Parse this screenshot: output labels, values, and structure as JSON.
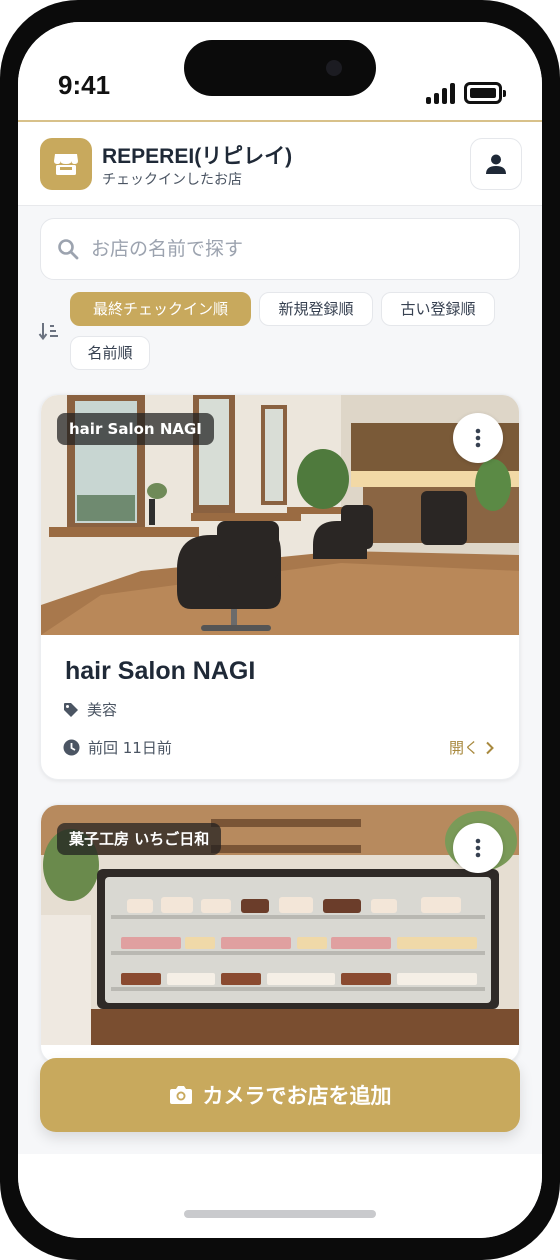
{
  "status_bar": {
    "time": "9:41"
  },
  "header": {
    "app_title": "REPEREI(リピレイ)",
    "subtitle": "チェックインしたお店",
    "logo_icon": "store-icon",
    "profile_icon": "user-icon"
  },
  "search": {
    "placeholder": "お店の名前で探す",
    "value": ""
  },
  "sort": {
    "options": [
      {
        "label": "最終チェックイン順",
        "active": true
      },
      {
        "label": "新規登録順",
        "active": false
      },
      {
        "label": "古い登録順",
        "active": false
      },
      {
        "label": "名前順",
        "active": false
      }
    ]
  },
  "stores": [
    {
      "name": "hair Salon NAGI",
      "badge": "hair Salon NAGI",
      "category": "美容",
      "last_visit": "前回 11日前",
      "open_label": "開く"
    },
    {
      "name": "菓子工房 いちご日和",
      "badge": "菓子工房 いちご日和"
    }
  ],
  "cta": {
    "label": "カメラでお店を追加",
    "icon": "camera-icon"
  },
  "colors": {
    "accent": "#c8a95d",
    "accent_text": "#a8893e"
  }
}
